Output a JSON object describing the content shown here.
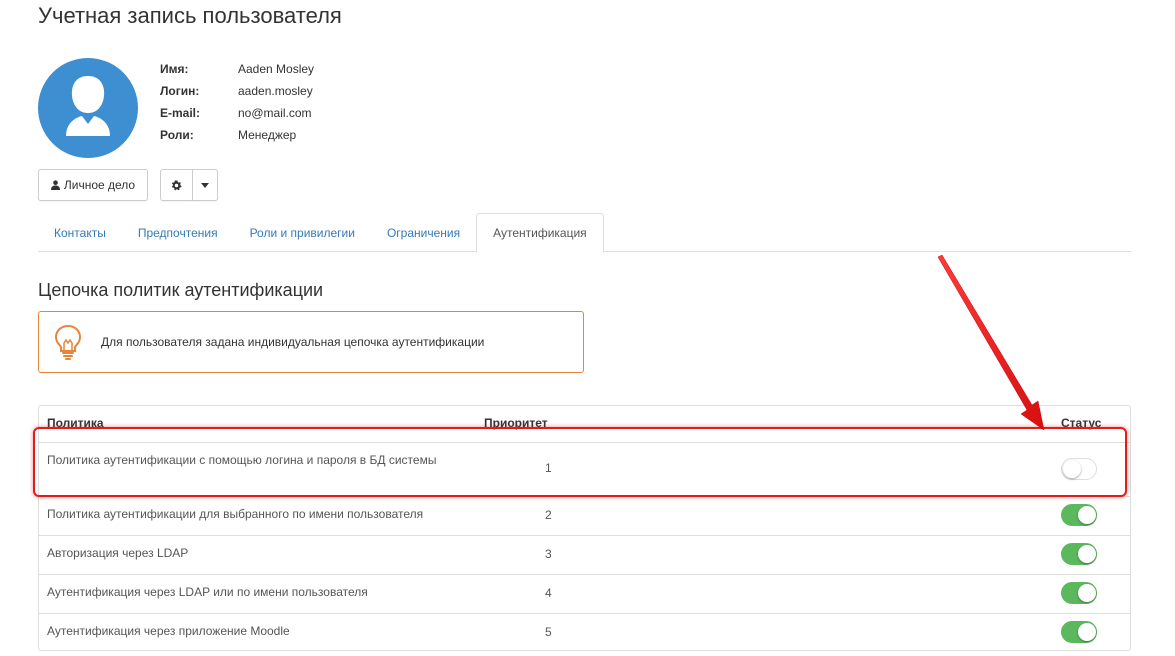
{
  "page": {
    "title": "Учетная запись пользователя"
  },
  "user": {
    "fields": [
      {
        "key": "Имя:",
        "value": "Aaden Mosley"
      },
      {
        "key": "Логин:",
        "value": "aaden.mosley"
      },
      {
        "key": "E-mail:",
        "value": "no@mail.com"
      },
      {
        "key": "Роли:",
        "value": "Менеджер"
      }
    ],
    "avatar_icon": "user-silhouette-icon",
    "avatar_color": "#3d8fd1"
  },
  "actions": {
    "personal_case_label": "Личное дело",
    "personal_case_icon": "user-icon",
    "settings_icon": "gear-icon",
    "dropdown_icon": "caret-down-icon"
  },
  "tabs": [
    {
      "label": "Контакты",
      "active": false
    },
    {
      "label": "Предпочтения",
      "active": false
    },
    {
      "label": "Роли и привилегии",
      "active": false
    },
    {
      "label": "Ограничения",
      "active": false
    },
    {
      "label": "Аутентификация",
      "active": true
    }
  ],
  "section": {
    "title": "Цепочка политик аутентификации"
  },
  "alert": {
    "icon": "lightbulb-icon",
    "color": "#e8833a",
    "text": "Для пользователя задана индивидуальная цепочка аутентификации"
  },
  "policy_table": {
    "headers": {
      "policy": "Политика",
      "priority": "Приоритет",
      "status": "Статус"
    },
    "rows": [
      {
        "name": "Политика аутентификации с помощью логина и пароля в БД системы",
        "priority": "1",
        "enabled": false
      },
      {
        "name": "Политика аутентификации для выбранного по имени пользователя",
        "priority": "2",
        "enabled": true
      },
      {
        "name": "Авторизация через LDAP",
        "priority": "3",
        "enabled": true
      },
      {
        "name": "Аутентификация через LDAP или по имени пользователя",
        "priority": "4",
        "enabled": true
      },
      {
        "name": "Аутентификация через приложение Moodle",
        "priority": "5",
        "enabled": true
      }
    ]
  },
  "colors": {
    "link": "#337ab7",
    "toggle_on": "#5cb85c",
    "annotation": "#e21b1b"
  }
}
